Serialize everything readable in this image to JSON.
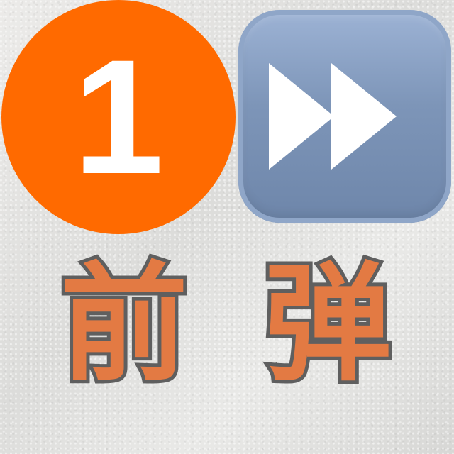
{
  "badge": {
    "number": "1",
    "color": "#ff6a00"
  },
  "fast_forward_tile": {
    "icon": "fast-forward-icon",
    "color": "#7d95b8"
  },
  "labels": {
    "left": "前",
    "right": "弹"
  },
  "text_fill_color": "#e37a43",
  "text_outline_color": "#5f5f5f"
}
